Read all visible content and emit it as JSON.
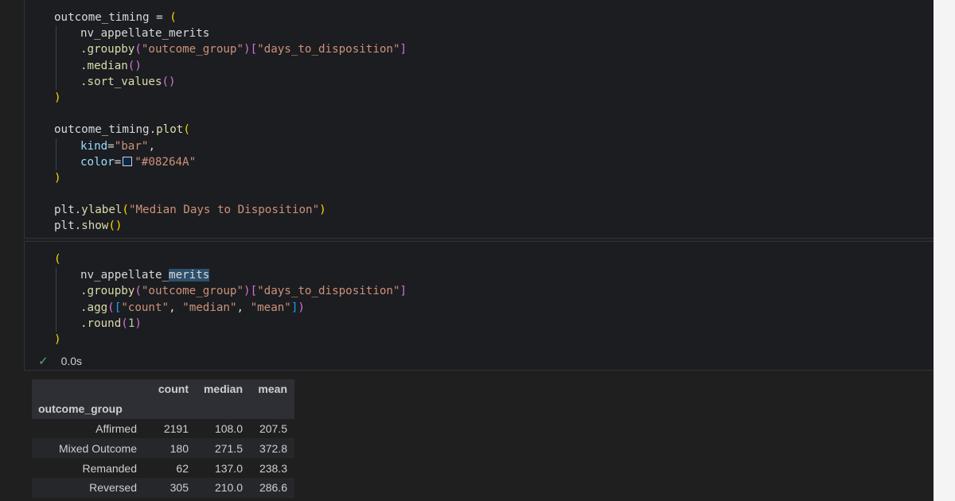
{
  "cell1": {
    "lines": [
      {
        "segs": [
          {
            "c": "v",
            "t": "outcome_timing = "
          },
          {
            "c": "b1",
            "t": "("
          }
        ]
      },
      {
        "indent": true,
        "segs": [
          {
            "c": "v",
            "t": "nv_appellate_merits"
          }
        ]
      },
      {
        "indent": true,
        "segs": [
          {
            "c": "p",
            "t": "."
          },
          {
            "c": "f",
            "t": "groupby"
          },
          {
            "c": "b2",
            "t": "("
          },
          {
            "c": "s",
            "t": "\"outcome_group\""
          },
          {
            "c": "b2",
            "t": ")"
          },
          {
            "c": "b2",
            "t": "["
          },
          {
            "c": "s",
            "t": "\"days_to_disposition\""
          },
          {
            "c": "b2",
            "t": "]"
          }
        ]
      },
      {
        "indent": true,
        "segs": [
          {
            "c": "p",
            "t": "."
          },
          {
            "c": "f",
            "t": "median"
          },
          {
            "c": "b2",
            "t": "()"
          }
        ]
      },
      {
        "indent": true,
        "segs": [
          {
            "c": "p",
            "t": "."
          },
          {
            "c": "f",
            "t": "sort_values"
          },
          {
            "c": "b2",
            "t": "()"
          }
        ]
      },
      {
        "segs": [
          {
            "c": "b1",
            "t": ")"
          }
        ]
      },
      {
        "segs": []
      },
      {
        "segs": [
          {
            "c": "v",
            "t": "outcome_timing"
          },
          {
            "c": "p",
            "t": "."
          },
          {
            "c": "f",
            "t": "plot"
          },
          {
            "c": "b1",
            "t": "("
          }
        ]
      },
      {
        "indent": true,
        "segs": [
          {
            "c": "pl",
            "t": "kind"
          },
          {
            "c": "p",
            "t": "="
          },
          {
            "c": "s",
            "t": "\"bar\""
          },
          {
            "c": "p",
            "t": ","
          }
        ]
      },
      {
        "indent": true,
        "segs": [
          {
            "c": "pl",
            "t": "color"
          },
          {
            "c": "p",
            "t": "="
          },
          {
            "c": "swatch",
            "t": ""
          },
          {
            "c": "s",
            "t": "\"#08264A\""
          }
        ]
      },
      {
        "segs": [
          {
            "c": "b1",
            "t": ")"
          }
        ]
      },
      {
        "segs": []
      },
      {
        "segs": [
          {
            "c": "v",
            "t": "plt"
          },
          {
            "c": "p",
            "t": "."
          },
          {
            "c": "f",
            "t": "ylabel"
          },
          {
            "c": "b1",
            "t": "("
          },
          {
            "c": "s",
            "t": "\"Median Days to Disposition\""
          },
          {
            "c": "b1",
            "t": ")"
          }
        ]
      },
      {
        "segs": [
          {
            "c": "v",
            "t": "plt"
          },
          {
            "c": "p",
            "t": "."
          },
          {
            "c": "f",
            "t": "show"
          },
          {
            "c": "b1",
            "t": "()"
          }
        ]
      }
    ]
  },
  "cell2": {
    "lines": [
      {
        "segs": [
          {
            "c": "b1",
            "t": "("
          }
        ]
      },
      {
        "indent": true,
        "segs": [
          {
            "c": "v",
            "t": "nv_appellate_"
          },
          {
            "c": "v hl",
            "t": "merits"
          }
        ]
      },
      {
        "indent": true,
        "segs": [
          {
            "c": "p",
            "t": "."
          },
          {
            "c": "f",
            "t": "groupby"
          },
          {
            "c": "b2",
            "t": "("
          },
          {
            "c": "s",
            "t": "\"outcome_group\""
          },
          {
            "c": "b2",
            "t": ")"
          },
          {
            "c": "b2",
            "t": "["
          },
          {
            "c": "s",
            "t": "\"days_to_disposition\""
          },
          {
            "c": "b2",
            "t": "]"
          }
        ]
      },
      {
        "indent": true,
        "segs": [
          {
            "c": "p",
            "t": "."
          },
          {
            "c": "f",
            "t": "agg"
          },
          {
            "c": "b2",
            "t": "("
          },
          {
            "c": "b3",
            "t": "["
          },
          {
            "c": "s",
            "t": "\"count\""
          },
          {
            "c": "p",
            "t": ", "
          },
          {
            "c": "s",
            "t": "\"median\""
          },
          {
            "c": "p",
            "t": ", "
          },
          {
            "c": "s",
            "t": "\"mean\""
          },
          {
            "c": "b3",
            "t": "]"
          },
          {
            "c": "b2",
            "t": ")"
          }
        ]
      },
      {
        "indent": true,
        "segs": [
          {
            "c": "p",
            "t": "."
          },
          {
            "c": "f",
            "t": "round"
          },
          {
            "c": "b2",
            "t": "("
          },
          {
            "c": "n",
            "t": "1"
          },
          {
            "c": "b2",
            "t": ")"
          }
        ]
      },
      {
        "segs": [
          {
            "c": "b1",
            "t": ")"
          }
        ]
      }
    ],
    "status_time": "0.0s"
  },
  "table": {
    "columns": [
      "count",
      "median",
      "mean"
    ],
    "index_name": "outcome_group",
    "rows": [
      {
        "label": "Affirmed",
        "count": "2191",
        "median": "108.0",
        "mean": "207.5"
      },
      {
        "label": "Mixed Outcome",
        "count": "180",
        "median": "271.5",
        "mean": "372.8"
      },
      {
        "label": "Remanded",
        "count": "62",
        "median": "137.0",
        "mean": "238.3"
      },
      {
        "label": "Reversed",
        "count": "305",
        "median": "210.0",
        "mean": "286.6"
      }
    ]
  },
  "icons": {
    "status": "check-icon",
    "color_swatch": "color-swatch-icon"
  },
  "colors": {
    "swatch": "#08264A",
    "status_ok": "#5fa77a"
  }
}
